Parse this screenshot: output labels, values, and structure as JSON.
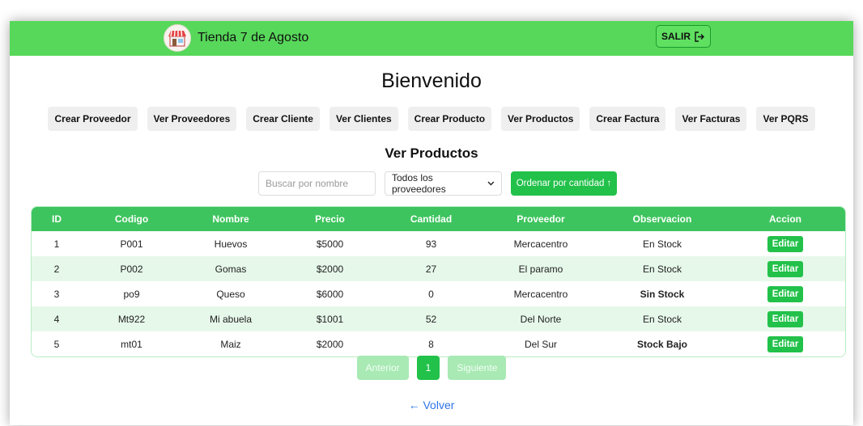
{
  "navbar": {
    "title": "Tienda 7 de Agosto",
    "logout_label": "SALIR"
  },
  "heading": "Bienvenido",
  "menu": [
    "Crear Proveedor",
    "Ver Proveedores",
    "Crear Cliente",
    "Ver Clientes",
    "Crear Producto",
    "Ver Productos",
    "Crear Factura",
    "Ver Facturas",
    "Ver PQRS"
  ],
  "section_title": "Ver Productos",
  "filters": {
    "search_placeholder": "Buscar por nombre",
    "provider_selected": "Todos los proveedores",
    "sort_label": "Ordenar por cantidad ↑"
  },
  "table": {
    "headers": [
      "ID",
      "Codigo",
      "Nombre",
      "Precio",
      "Cantidad",
      "Proveedor",
      "Observacion",
      "Accion"
    ],
    "rows": [
      {
        "id": "1",
        "codigo": "P001",
        "nombre": "Huevos",
        "precio": "$5000",
        "cantidad": "93",
        "proveedor": "Mercacentro",
        "observacion": "En Stock",
        "accion": "Editar"
      },
      {
        "id": "2",
        "codigo": "P002",
        "nombre": "Gomas",
        "precio": "$2000",
        "cantidad": "27",
        "proveedor": "El paramo",
        "observacion": "En Stock",
        "accion": "Editar"
      },
      {
        "id": "3",
        "codigo": "po9",
        "nombre": "Queso",
        "precio": "$6000",
        "cantidad": "0",
        "proveedor": "Mercacentro",
        "observacion": "Sin Stock",
        "accion": "Editar"
      },
      {
        "id": "4",
        "codigo": "Mt922",
        "nombre": "Mi abuela",
        "precio": "$1001",
        "cantidad": "52",
        "proveedor": "Del Norte",
        "observacion": "En Stock",
        "accion": "Editar"
      },
      {
        "id": "5",
        "codigo": "mt01",
        "nombre": "Maiz",
        "precio": "$2000",
        "cantidad": "8",
        "proveedor": "Del Sur",
        "observacion": "Stock Bajo",
        "accion": "Editar"
      }
    ]
  },
  "pagination": {
    "prev": "Anterior",
    "current": "1",
    "next": "Siguiente"
  },
  "back_link": "← Volver",
  "colors": {
    "navbar": "#57d85a",
    "accent": "#22c14a",
    "table_header": "#3ec45e",
    "row_alt": "#e6f8ea",
    "link": "#2d74e8"
  }
}
